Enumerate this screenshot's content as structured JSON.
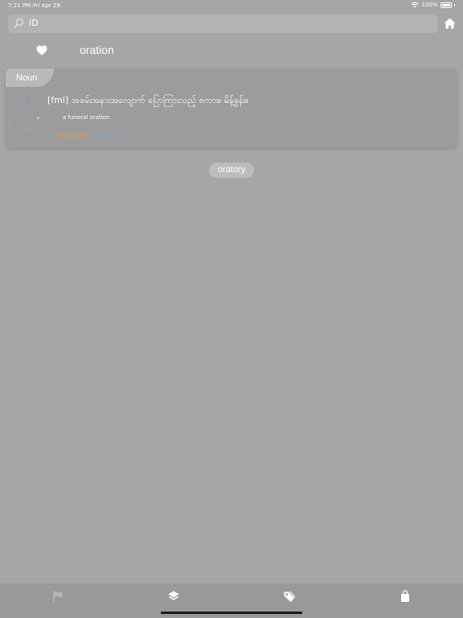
{
  "status_bar": {
    "time": "7:21 PM",
    "date": "Fri Apr 29",
    "battery": "100%"
  },
  "search": {
    "query": "ID"
  },
  "entry": {
    "word": "oration",
    "part_of_speech": "Noun",
    "definition": "[fml] အခမ်းအနားအလျောက် ပြောကြားသည့် စကား။ မိန့်ခွန်း။",
    "example": "a funeral oration.",
    "plural_arrow": "→",
    "plural_word": "orations",
    "plural_label": "(plural)"
  },
  "related": {
    "word": "oratory"
  },
  "tab_bar": {
    "items": [
      "flag-icon",
      "layers-icon",
      "tag-icon",
      "bag-icon"
    ]
  },
  "colors": {
    "background": "#a6a6a6",
    "card": "#9c9c9c",
    "accent_blue": "#8aa6c8",
    "accent_orange": "#d59a55"
  }
}
